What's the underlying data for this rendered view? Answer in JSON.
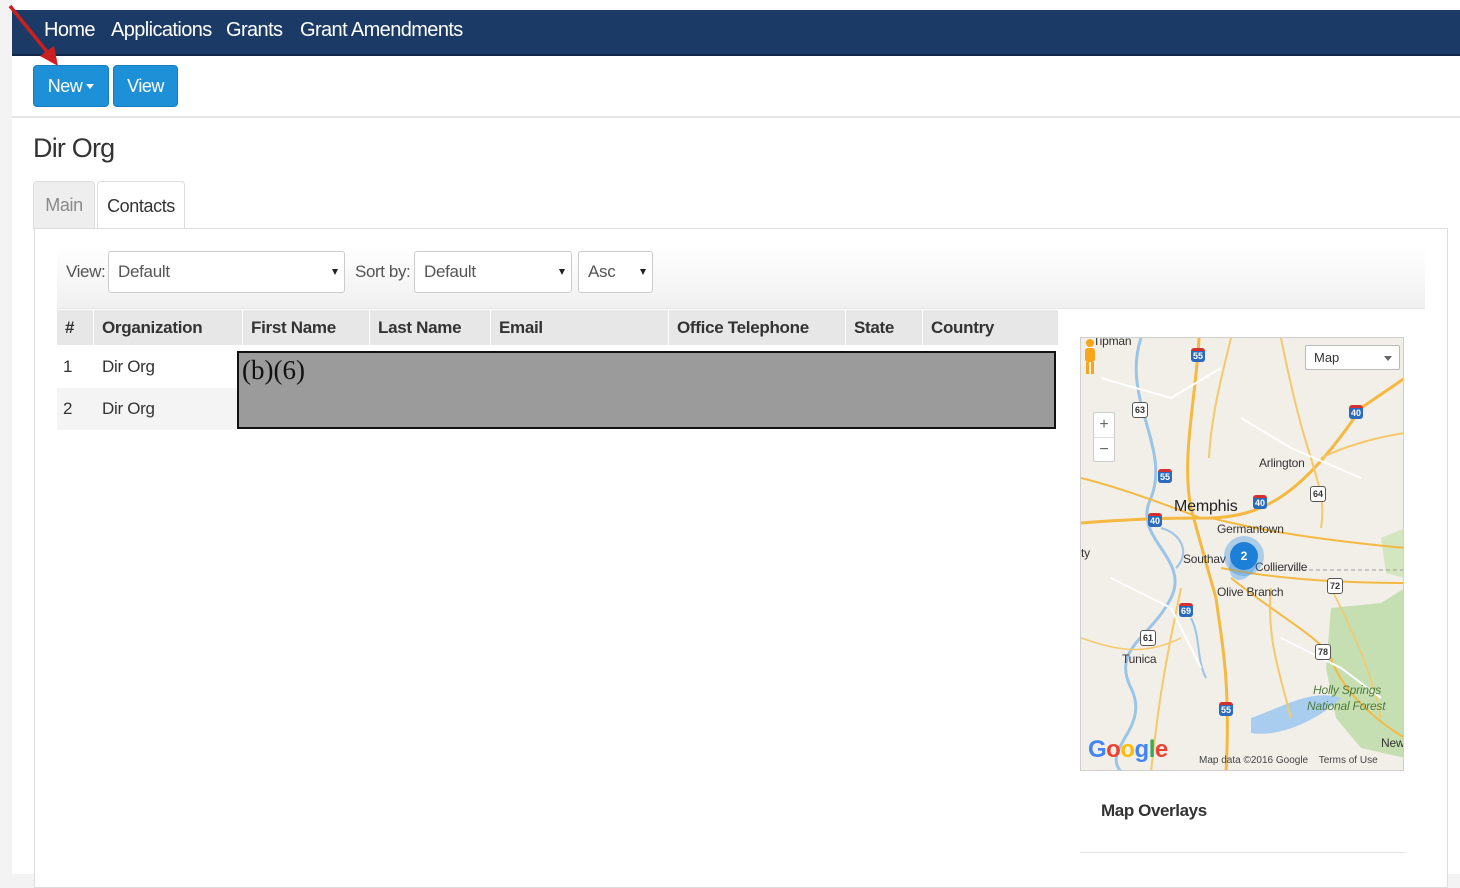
{
  "nav": {
    "items": [
      "Home",
      "Applications",
      "Grants",
      "Grant Amendments"
    ]
  },
  "toolbar": {
    "new_label": "New",
    "view_label": "View"
  },
  "page": {
    "title": "Dir Org"
  },
  "tabs": {
    "main": "Main",
    "contacts": "Contacts",
    "active": "Contacts"
  },
  "filters": {
    "view_label": "View:",
    "view_value": "Default",
    "sort_label": "Sort by:",
    "sort_value": "Default",
    "order_value": "Asc"
  },
  "table": {
    "columns": [
      "#",
      "Organization",
      "First Name",
      "Last Name",
      "Email",
      "Office Telephone",
      "State",
      "Country"
    ],
    "rows": [
      {
        "num": "1",
        "organization": "Dir Org"
      },
      {
        "num": "2",
        "organization": "Dir Org"
      }
    ],
    "redaction_label": "(b)(6)"
  },
  "map": {
    "type_label": "Map",
    "cluster_count": "2",
    "zoom_in": "+",
    "zoom_out": "−",
    "labels": {
      "top_cut": "Tipman",
      "arlington": "Arlington",
      "memphis": "Memphis",
      "germantown": "Germantown",
      "southaven": "Southav",
      "collierville": "Collierville",
      "olive_branch": "Olive Branch",
      "tunica": "Tunica",
      "holly1": "Holly Springs",
      "holly2": "National Forest",
      "new": "New",
      "ty": "ty"
    },
    "shields": {
      "i55_top": "55",
      "i40_right": "40",
      "us63": "63",
      "i55_mid": "55",
      "us64": "64",
      "i40_center": "40",
      "i40_left": "40",
      "us72": "72",
      "i69": "69",
      "us61": "61",
      "us78": "78",
      "i55_bottom": "55"
    },
    "logo": "Google",
    "attribution": "Map data ©2016 Google",
    "terms": "Terms of Use"
  },
  "overlays": {
    "title": "Map Overlays"
  },
  "colors": {
    "navbar": "#1b3b66",
    "button": "#1e90d8",
    "annotation_arrow": "#cc1f1f",
    "redaction": "#9b9b9b"
  }
}
